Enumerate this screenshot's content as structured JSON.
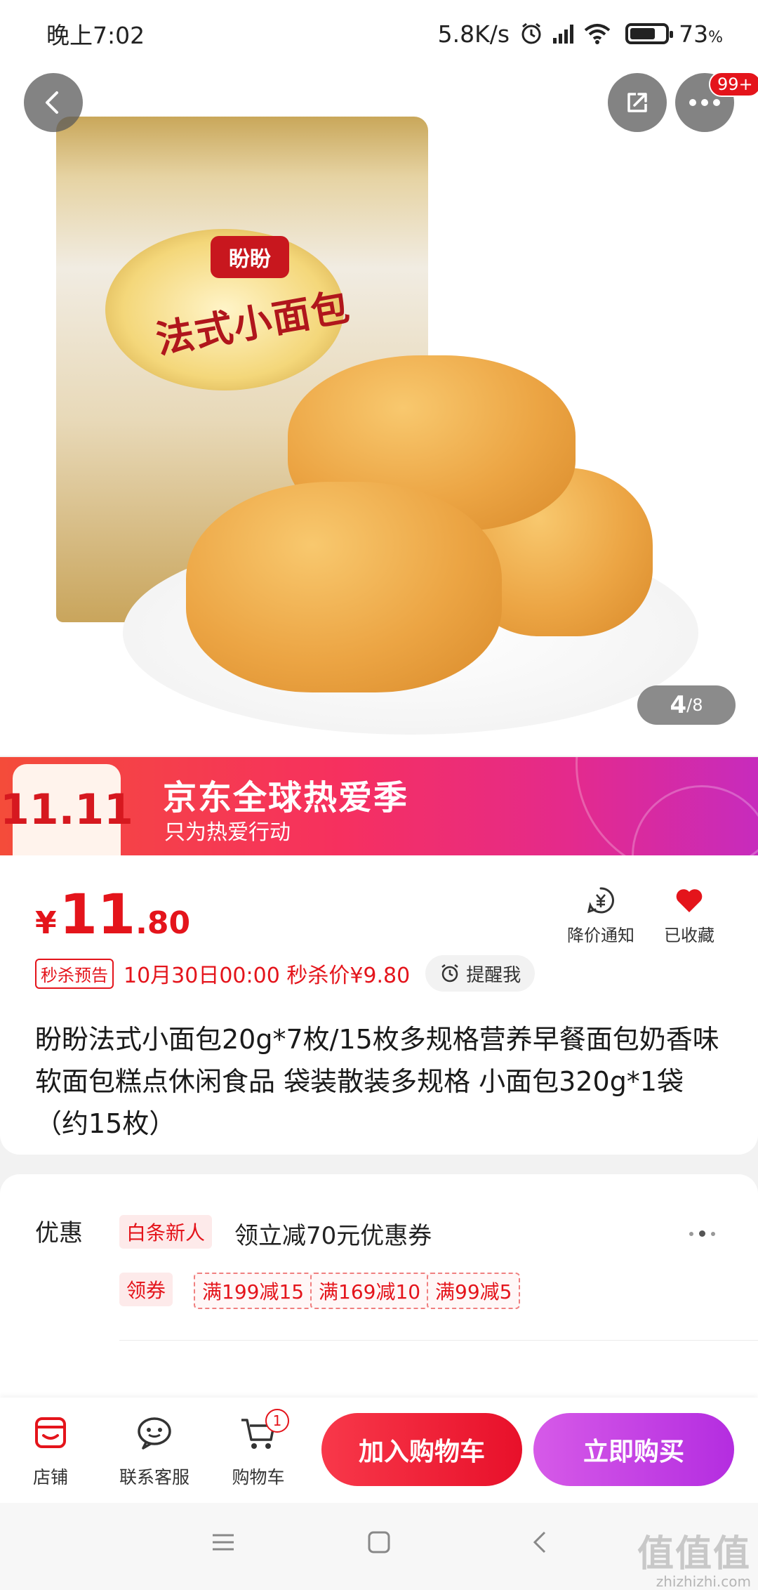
{
  "status_bar": {
    "time": "晚上7:02",
    "speed": "5.8K/s",
    "network": "HD",
    "battery": "73",
    "battery_unit": "%",
    "battery_level": 0.73
  },
  "hero": {
    "more_badge": "99+",
    "page_current": "4",
    "page_total": "/8",
    "bag_brand": "盼盼",
    "bag_title": "法式小面包"
  },
  "banner": {
    "logo": "11.11",
    "title": "京东全球热爱季",
    "subtitle": "只为热爱行动"
  },
  "price": {
    "currency": "¥",
    "integer": "11",
    "decimal": ".80"
  },
  "actions": {
    "notify_label": "降价通知",
    "favorite_label": "已收藏"
  },
  "seckill": {
    "tag": "秒杀预告",
    "text": "10月30日00:00 秒杀价¥9.80",
    "remind_label": "提醒我"
  },
  "product_title": "盼盼法式小面包20g*7枚/15枚多规格营养早餐面包奶香味软面包糕点休闲食品 袋装散装多规格 小面包320g*1袋（约15枚）",
  "promo": {
    "label": "优惠",
    "tag": "白条新人",
    "text": "领立减70元优惠券",
    "coupon_tag": "领券",
    "coupons": [
      "满199减15",
      "满169减10",
      "满99减5"
    ]
  },
  "bottom_bar": {
    "store_label": "店铺",
    "service_label": "联系客服",
    "cart_label": "购物车",
    "cart_count": "1",
    "add_to_cart": "加入购物车",
    "buy_now": "立即购买"
  },
  "watermark": {
    "logo": "值值值",
    "url": "zhizhizhi.com"
  },
  "colors": {
    "accent": "#e4141b",
    "buy_button": "#c23ae4",
    "banner": "#f6305f"
  }
}
